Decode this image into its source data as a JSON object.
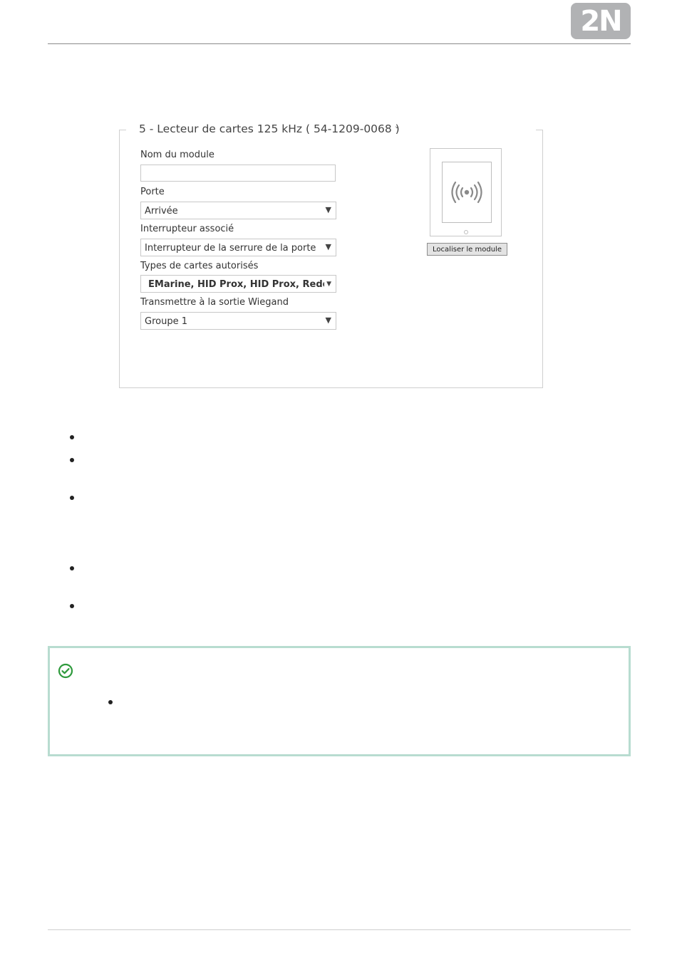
{
  "header": {
    "logo_text": "2N"
  },
  "module_panel": {
    "title": "5 - Lecteur de cartes 125 kHz ( 54-1209-0068 )",
    "chevron": "˅",
    "fields": {
      "module_name": {
        "label": "Nom du module",
        "value": ""
      },
      "door": {
        "label": "Porte",
        "value": "Arrivée"
      },
      "switch": {
        "label": "Interrupteur associé",
        "value": "Interrupteur de la serrure de la porte"
      },
      "card_types": {
        "label": "Types de cartes autorisés",
        "value": "EMarine, HID Prox, HID Prox, Rederia, H"
      },
      "wiegand": {
        "label": "Transmettre à la sortie Wiegand",
        "value": "Groupe 1"
      }
    },
    "dropdown_arrow": "▼",
    "locate_button": "Localiser le module",
    "device_icon": "rfid-wave-icon"
  },
  "bullets_count": 5,
  "note": {
    "icon": "check-circle-icon",
    "accent_color": "#2e9a3c",
    "border_color": "#b8dcd0"
  }
}
